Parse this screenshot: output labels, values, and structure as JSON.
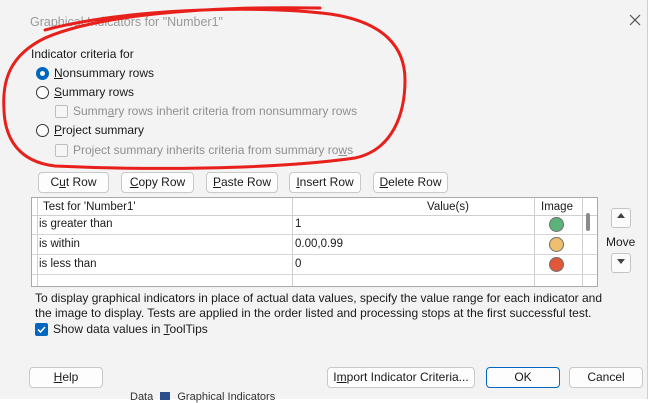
{
  "dialog": {
    "title": "Graphical Indicators for \"Number1\""
  },
  "criteria": {
    "group_label": "Indicator criteria for",
    "options": [
      {
        "label_u": "N",
        "label_rest": "onsummary rows",
        "selected": true
      },
      {
        "label_u": "S",
        "label_rest": "ummary rows",
        "selected": false
      },
      {
        "label_u": "P",
        "label_rest": "roject summary",
        "selected": false
      }
    ],
    "inherit_summary": {
      "pre": "Summ",
      "u": "a",
      "post": "ry rows inherit criteria from nonsummary rows",
      "checked": false
    },
    "inherit_project": {
      "pre": "Project summary inherits criteria from summary ro",
      "u": "w",
      "post": "s",
      "checked": false
    }
  },
  "row_buttons": [
    {
      "pre": "C",
      "u": "u",
      "post": "t Row"
    },
    {
      "pre": "",
      "u": "C",
      "post": "opy Row"
    },
    {
      "pre": "",
      "u": "P",
      "post": "aste Row"
    },
    {
      "pre": "",
      "u": "I",
      "post": "nsert Row"
    },
    {
      "pre": "",
      "u": "D",
      "post": "elete Row"
    }
  ],
  "grid": {
    "headers": {
      "test": "Test for 'Number1'",
      "value": "Value(s)",
      "image": "Image"
    },
    "rows": [
      {
        "test": "is greater than",
        "value": "1",
        "image_color": "#5cb37a"
      },
      {
        "test": "is within",
        "value": "0.00,0.99",
        "image_color": "#f0be6e"
      },
      {
        "test": "is less than",
        "value": "0",
        "image_color": "#e0583a"
      }
    ]
  },
  "move_label": "Move",
  "info_text": "To display graphical indicators in place of actual data values, specify the value range for each indicator and the image to display.  Tests are applied in the order listed and processing stops at the first successful test.",
  "tooltips_checkbox": {
    "pre": "Show data values in ",
    "u": "T",
    "post": "oolTips",
    "checked": true
  },
  "footer": {
    "help": {
      "u": "H",
      "post": "elp"
    },
    "import": {
      "pre": "I",
      "u": "m",
      "post": "port Indicator Criteria..."
    },
    "ok": "OK",
    "cancel": "Cancel"
  },
  "background_text": {
    "data": "Data",
    "graphical": "Graphical Indicators"
  },
  "colors": {
    "accent": "#0067c0",
    "annotation_red": "#e8201c"
  }
}
